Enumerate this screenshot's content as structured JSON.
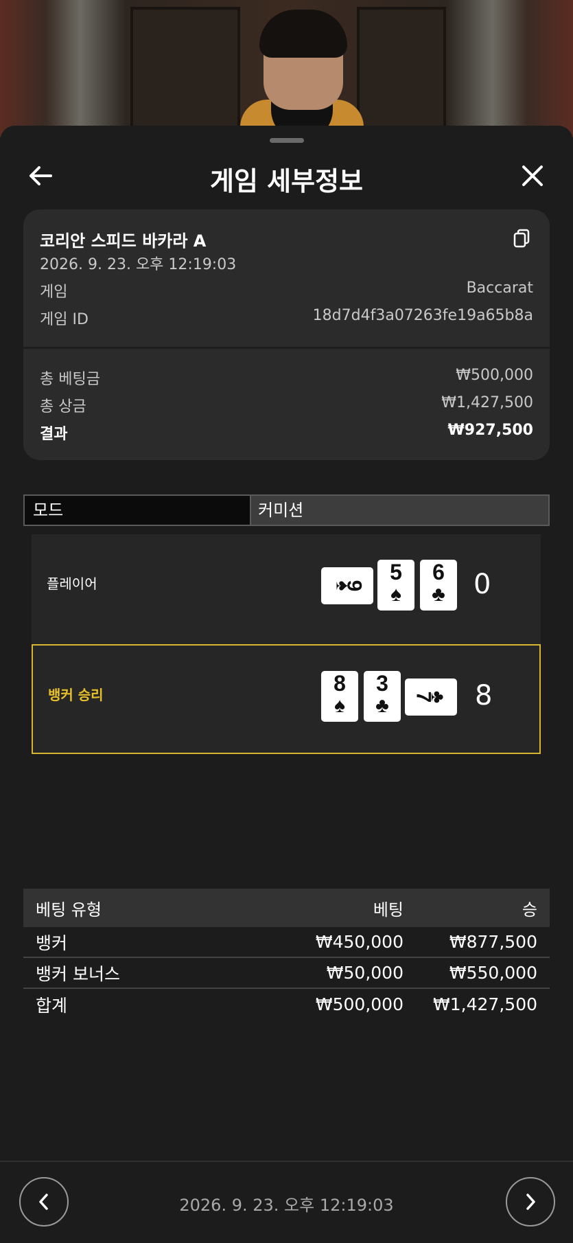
{
  "header": {
    "title": "게임 세부정보",
    "back_icon": "arrow-left-icon",
    "close_icon": "close-icon"
  },
  "game": {
    "name": "코리안 스피드 바카라 A",
    "datetime": "2026. 9. 23. 오후 12:19:03",
    "copy_icon": "copy-icon",
    "game_label": "게임",
    "game_value": "Baccarat",
    "id_label": "게임 ID",
    "id_value": "18d7d4f3a07263fe19a65b8a"
  },
  "summary": {
    "total_bet_label": "총 베팅금",
    "total_bet_value": "₩500,000",
    "total_payout_label": "총 상금",
    "total_payout_value": "₩1,427,500",
    "result_label": "결과",
    "result_value": "₩927,500"
  },
  "mode": {
    "left_label": "모드",
    "right_label": "커미션"
  },
  "hands": {
    "player": {
      "label": "플레이어",
      "score": "0",
      "cards": [
        {
          "rank": "9",
          "suit": "♠",
          "orientation": "sideways"
        },
        {
          "rank": "5",
          "suit": "♠",
          "orientation": "upright"
        },
        {
          "rank": "6",
          "suit": "♣",
          "orientation": "upright"
        }
      ]
    },
    "banker": {
      "label": "뱅커 승리",
      "score": "8",
      "cards": [
        {
          "rank": "8",
          "suit": "♠",
          "orientation": "upright"
        },
        {
          "rank": "3",
          "suit": "♣",
          "orientation": "upright"
        },
        {
          "rank": "7",
          "suit": "♣",
          "orientation": "sideways"
        }
      ]
    },
    "win_color": "#d8b52e"
  },
  "bets": {
    "headers": {
      "type": "베팅 유형",
      "bet": "베팅",
      "win": "승"
    },
    "rows": [
      {
        "type": "뱅커",
        "bet": "₩450,000",
        "win": "₩877,500"
      },
      {
        "type": "뱅커 보너스",
        "bet": "₩50,000",
        "win": "₩550,000"
      }
    ],
    "total": {
      "type": "합계",
      "bet": "₩500,000",
      "win": "₩1,427,500"
    }
  },
  "footer": {
    "datetime": "2026. 9. 23. 오후 12:19:03",
    "prev_icon": "chevron-left-icon",
    "next_icon": "chevron-right-icon"
  }
}
